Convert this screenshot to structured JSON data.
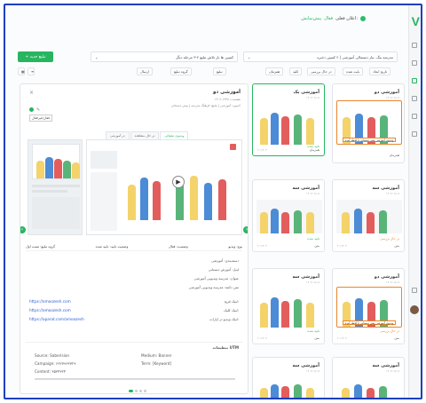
{
  "header": {
    "title": "اعلان فعلی: ",
    "status": "فعال",
    "status_user": "پیش‌نمایش"
  },
  "toolbar": {
    "new_button": "+ تبلیغ جدید",
    "campaign_select": "مدرسه بنگ. نیاز دستمالی آموزشی | ۲ کمپین ذخیره",
    "placement_select": "کمپین ها بار تلاش تبلیغ ۲-۳ مرحله دیگر"
  },
  "filters": [
    "تاریخ ایجاد",
    "بایت شده",
    "در حال بررسی",
    "کلید",
    "همزمان",
    "تبلیغ",
    "گروه تبلیغ",
    "ارسال"
  ],
  "panel": {
    "title": "آموزشی دو",
    "line1": "نشست: ۱۲۳۸-۱۴۰۲",
    "line2": "کمپین: آموزشی | تبلیغ: فرهنگ مدرسه | پیش دبستانی",
    "action_label": "فعال/غیرفعال",
    "tabs": [
      "ویدیوی تبلیغاتی",
      "در حال مشاهده",
      "در آموزشی"
    ],
    "status_type": "نوع: ویدیو",
    "status_active": "وضعیت: فعال",
    "status_verify": "وضعیت تایید: تایید شده",
    "status_group": "گروه تبلیغ: تست اول",
    "info": [
      "دسته‌بندی: آموزشی",
      "لیبل: آموزش دبستانی",
      "عنوان: مدرسه ویدیویی آموزشی",
      "متن دکمه: مدرسه ویدیویی آموزشی"
    ],
    "links": [
      {
        "label": "لینک فرود:",
        "url": "https://amoozesh.com"
      },
      {
        "label": "لینک کلیک:",
        "url": "https://amoozesh.com"
      },
      {
        "label": "لینک ویدیو در اپارات:",
        "url": "https://aparat.com/amoozesh"
      }
    ],
    "utm_title": "تنظیمات UTM",
    "utm": {
      "source": "Source: Saberision",
      "medium": "Medium: Banner",
      "campaign": "Campaign: ۶۶۲۷۹۶۳۷۲۹",
      "term": "Term: [Keyword]",
      "content": "Content: ۳۵۳۴۳۲۴"
    }
  },
  "cards": [
    {
      "title": "آموزشی یک",
      "sub": "۱۴۰۲/۰۸/۰۵",
      "tag": "تایید شده",
      "foot": "همزمان",
      "small": "۲۰/۱۴۰۳"
    },
    {
      "title": "آموزشی دو",
      "sub": "۱۴۰۲/۰۸/۰۵",
      "tag": "",
      "foot": "همزمان",
      "small": "۲۰/۱۴۰۳"
    },
    {
      "title": "آموزشی سه",
      "sub": "۱۴۰۲/۰۸/۰۵",
      "tag": "تایید شده",
      "foot": "متن",
      "small": "۲۰/۱۴۰۳"
    },
    {
      "title": "آموزشی سه",
      "sub": "۱۴۰۲/۰۸/۰۵",
      "tag": "در حال بررسی",
      "foot": "متن",
      "small": "۲۰/۱۴۰۳"
    },
    {
      "title": "آموزشی سه",
      "sub": "۱۴۰۲/۰۸/۰۵",
      "tag": "تایید شده",
      "foot": "متن",
      "small": "۲۰/۱۴۰۳"
    },
    {
      "title": "آموزشی دو",
      "sub": "۱۴۰۲/۰۸/۰۵",
      "tag": "در حال بررسی",
      "foot": "متن",
      "small": "۲۰/۱۴۰۳"
    },
    {
      "title": "آموزشی سه",
      "sub": "۱۴۰۲/۰۸/۰۵",
      "tag": "تایید شده",
      "foot": "",
      "small": ""
    },
    {
      "title": "آموزشی سه",
      "sub": "۱۴۰۲/۰۸/۰۵",
      "tag": "",
      "foot": "",
      "small": ""
    }
  ],
  "banner_text": "ویدیوی آموزشی پیش دبستانی با لحظه آینده",
  "colors": {
    "accent": "#27b560",
    "banner_border": "#e8862c",
    "link": "#2a5bd7"
  },
  "icons": [
    "logo-v",
    "bell-icon",
    "search-icon",
    "chevron-down-icon",
    "play-icon",
    "arrow-left-icon",
    "arrow-right-icon",
    "close-icon",
    "link-icon"
  ]
}
